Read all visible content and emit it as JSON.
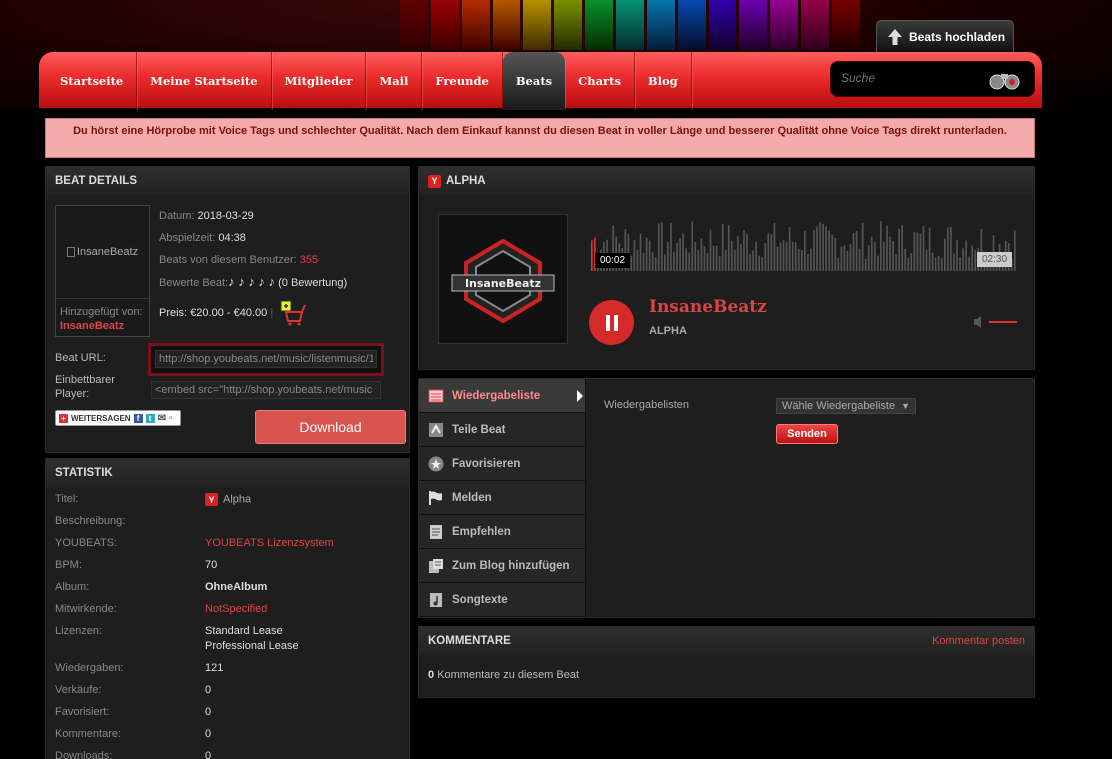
{
  "header": {
    "upload_label": "Beats hochladen",
    "nav": [
      "Startseite",
      "Meine Startseite",
      "Mitglieder",
      "Mail",
      "Freunde",
      "Beats",
      "Charts",
      "Blog"
    ],
    "active_nav": "Beats",
    "search_placeholder": "Suche"
  },
  "notice": "Du hörst eine Hörprobe mit Voice Tags und schlechter Qualität. Nach dem Einkauf kannst du diesen Beat in voller Länge und besserer Qualität ohne Voice Tags direkt runterladen.",
  "details": {
    "title": "BEAT DETAILS",
    "image_alt": "InsaneBeatz",
    "added_label": "Hinzugefügt von:",
    "added_by": "InsaneBeatz",
    "datum_label": "Datum:",
    "datum": "2018-03-29",
    "duration_label": "Abspielzeit:",
    "duration": "04:38",
    "user_beats_label": "Beats von diesem Benutzer:",
    "user_beats": "355",
    "rate_label": "Bewerte Beat:",
    "rating_count": "(0 Bewertung)",
    "price_label": "Preis:",
    "price": "€20.00 - €40.00",
    "url_label": "Beat URL:",
    "url": "http://shop.youbeats.net/music/listenmusic/1",
    "embed_label_1": "Einbettbarer",
    "embed_label_2": "Player:",
    "embed": "<embed src=\"http://shop.youbeats.net/music",
    "share_label": "WEITERSAGEN",
    "download": "Download"
  },
  "stats": {
    "title": "STATISTIK",
    "rows": [
      {
        "k": "Titel:",
        "v": "Alpha"
      },
      {
        "k": "Beschreibung:",
        "v": ""
      },
      {
        "k": "YOUBEATS:",
        "v": "YOUBEATS Lizenzsystem"
      },
      {
        "k": "BPM:",
        "v": "70"
      },
      {
        "k": "Album:",
        "v": "OhneAlbum"
      },
      {
        "k": "Mitwirkende:",
        "v": "NotSpecified"
      },
      {
        "k": "Lizenzen:",
        "v": "Standard Lease"
      },
      {
        "k": "",
        "v": "Professional Lease"
      },
      {
        "k": "Wiedergaben:",
        "v": "121"
      },
      {
        "k": "Verkäufe:",
        "v": "0"
      },
      {
        "k": "Favorisiert:",
        "v": "0"
      },
      {
        "k": "Kommentare:",
        "v": "0"
      },
      {
        "k": "Downloads:",
        "v": "0"
      }
    ]
  },
  "player": {
    "title": "ALPHA",
    "current": "00:02",
    "total": "02:30",
    "artist": "InsaneBeatz",
    "track": "ALPHA",
    "progress": 0.013,
    "cover_text": "InsaneBeatz"
  },
  "actions": {
    "items": [
      "Wiedergabeliste",
      "Teile Beat",
      "Favorisieren",
      "Melden",
      "Empfehlen",
      "Zum Blog hinzufügen",
      "Songtexte"
    ],
    "playlist_label": "Wiedergabelisten",
    "playlist_select": "Wähle Wiedergabeliste",
    "send": "Senden"
  },
  "comments": {
    "title": "KOMMENTARE",
    "post": "Kommentar posten",
    "count": "0",
    "count_text": "Kommentare zu diesem Beat"
  }
}
